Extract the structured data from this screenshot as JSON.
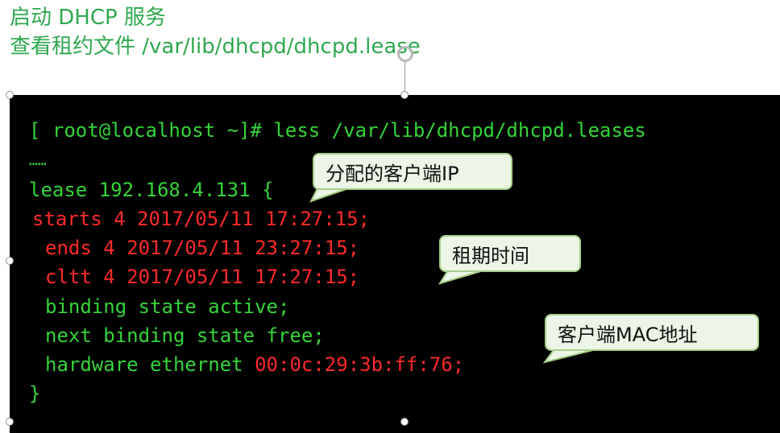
{
  "slide": {
    "heading_line1": "启动 DHCP 服务",
    "heading_line2": "查看租约文件 /var/lib/dhcpd/dhcpd.lease"
  },
  "terminal": {
    "prompt": "[ root@localhost ~]# ",
    "command": "less /var/lib/dhcpd/dhcpd.leases",
    "ellipsis": "……",
    "lease_keyword": "lease",
    "lease_ip": "192.168.4.131",
    "open_brace": "{",
    "starts": "starts 4 2017/05/11 17:27:15;",
    "ends": "ends 4 2017/05/11 23:27:15;",
    "cltt": "cltt 4 2017/05/11 17:27:15;",
    "binding_state": "binding state active;",
    "next_binding_state": "next binding state free;",
    "hardware_label": "hardware ethernet",
    "hardware_mac": "00:0c:29:3b:ff:76;",
    "close_brace": "}"
  },
  "callouts": {
    "ip": "分配的客户端IP",
    "lease_time": "租期时间",
    "mac": "客户端MAC地址"
  },
  "colors": {
    "heading": "#2fa84f",
    "terminal_bg": "#000000",
    "terminal_green": "#35d43a",
    "terminal_red": "#ff2a2a",
    "callout_fill": "#ecf5e6",
    "callout_border": "#a6cf86"
  },
  "icons": {
    "rotate_handle": "rotate-handle-icon",
    "resize_handle": "resize-handle-icon"
  }
}
